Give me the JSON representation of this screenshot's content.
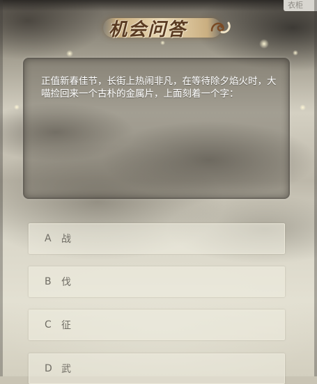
{
  "header": {
    "logo_text": "机会问答",
    "corner_tag": "衣柜"
  },
  "question": {
    "text": "正值新春佳节，长街上热闹非凡，在等待除夕焰火时，大喵捡回来一个古朴的金属片，上面刻着一个字："
  },
  "options": [
    {
      "letter": "A",
      "text": "战"
    },
    {
      "letter": "B",
      "text": "伐"
    },
    {
      "letter": "C",
      "text": "征"
    },
    {
      "letter": "D",
      "text": "武"
    }
  ],
  "colors": {
    "panel": "#5f5a52",
    "option_border": "#ebe8da",
    "option_text": "#6f6c64",
    "logo_text": "#5a3b22"
  },
  "icons": {
    "logo_swirl": "cloud-swirl-icon"
  }
}
